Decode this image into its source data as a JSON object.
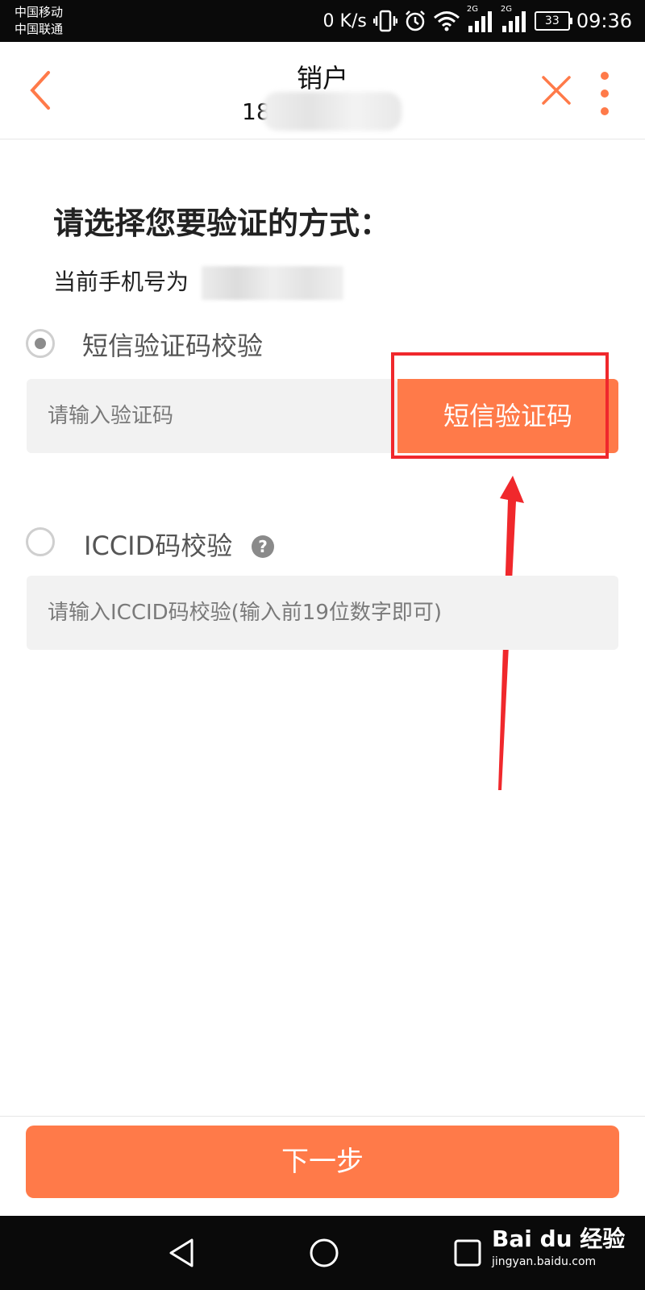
{
  "status_bar": {
    "carrier1": "中国移动",
    "carrier2": "中国联通",
    "net_speed": "0 K/s",
    "network_type_1": "2G",
    "network_type_2": "2G",
    "battery": "33",
    "time": "09:36"
  },
  "header": {
    "title": "销户",
    "subtitle_prefix": "18"
  },
  "content": {
    "heading": "请选择您要验证的方式：",
    "phone_label": "当前手机号为",
    "option_sms": {
      "label": "短信验证码校验",
      "selected": true,
      "input_placeholder": "请输入验证码",
      "button_label": "短信验证码"
    },
    "option_iccid": {
      "label": "ICCID码校验",
      "selected": false,
      "help": "?",
      "input_placeholder": "请输入ICCID码校验(输入前19位数字即可)"
    }
  },
  "footer": {
    "next_label": "下一步"
  },
  "watermark": {
    "brand": "Bai du 经验",
    "url": "jingyan.baidu.com"
  },
  "colors": {
    "accent": "#ff7a49",
    "highlight": "#f0282c",
    "input_bg": "#f2f2f2"
  }
}
